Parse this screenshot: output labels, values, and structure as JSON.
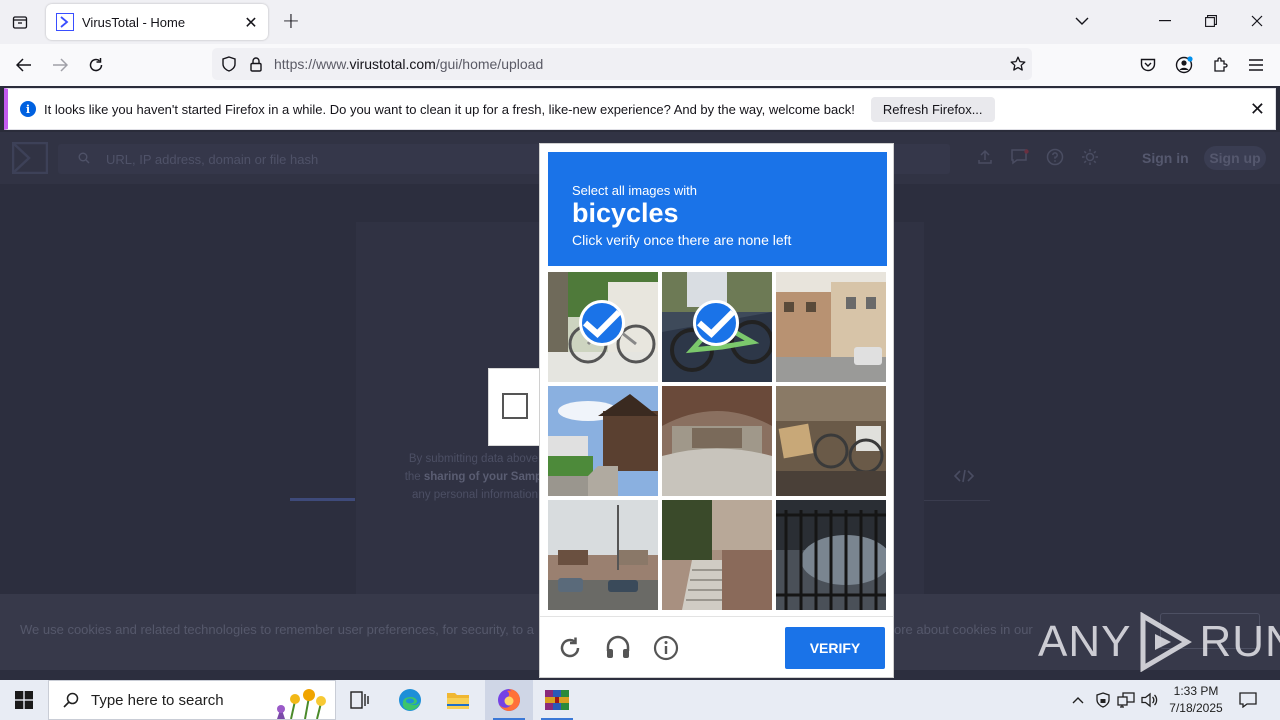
{
  "browser": {
    "tab_title": "VirusTotal - Home",
    "url_prefix": "https://www.",
    "url_domain": "virustotal.com",
    "url_path": "/gui/home/upload",
    "notification": {
      "message": "It looks like you haven't started Firefox in a while. Do you want to clean it up for a fresh, like-new experience? And by the way, welcome back!",
      "button_label": "Refresh Firefox..."
    }
  },
  "page": {
    "search_placeholder": "URL, IP address, domain or file hash",
    "sign_in": "Sign in",
    "sign_up": "Sign up",
    "terms_line1": "By submitting data above,",
    "terms_line2_pre": "the ",
    "terms_line2_bold": "sharing of your Sampl",
    "terms_line3": "any personal information",
    "cookie_text": "We use cookies and related technologies to remember user preferences, for security, to a",
    "cookie_text_right": "ore about cookies in our"
  },
  "captcha": {
    "instruction": "Select all images with",
    "target": "bicycles",
    "hint": "Click verify once there are none left",
    "tiles": [
      {
        "name": "tile-bicycle-wall",
        "selected": true
      },
      {
        "name": "tile-green-bicycle",
        "selected": true
      },
      {
        "name": "tile-street-buildings",
        "selected": false
      },
      {
        "name": "tile-house-path",
        "selected": false
      },
      {
        "name": "tile-garage",
        "selected": false
      },
      {
        "name": "tile-bicycle-yard",
        "selected": false
      },
      {
        "name": "tile-parking-lot",
        "selected": false
      },
      {
        "name": "tile-stairs-building",
        "selected": false
      },
      {
        "name": "tile-railing-car",
        "selected": false
      }
    ],
    "verify_label": "VERIFY"
  },
  "watermark": "ANY RUN",
  "taskbar": {
    "search_placeholder": "Type here to search",
    "time": "1:33 PM",
    "date": "7/18/2025"
  },
  "colors": {
    "captcha_blue": "#1a73e8",
    "firefox_accent": "#c45bf0",
    "page_dim": "#2c2e3e"
  }
}
